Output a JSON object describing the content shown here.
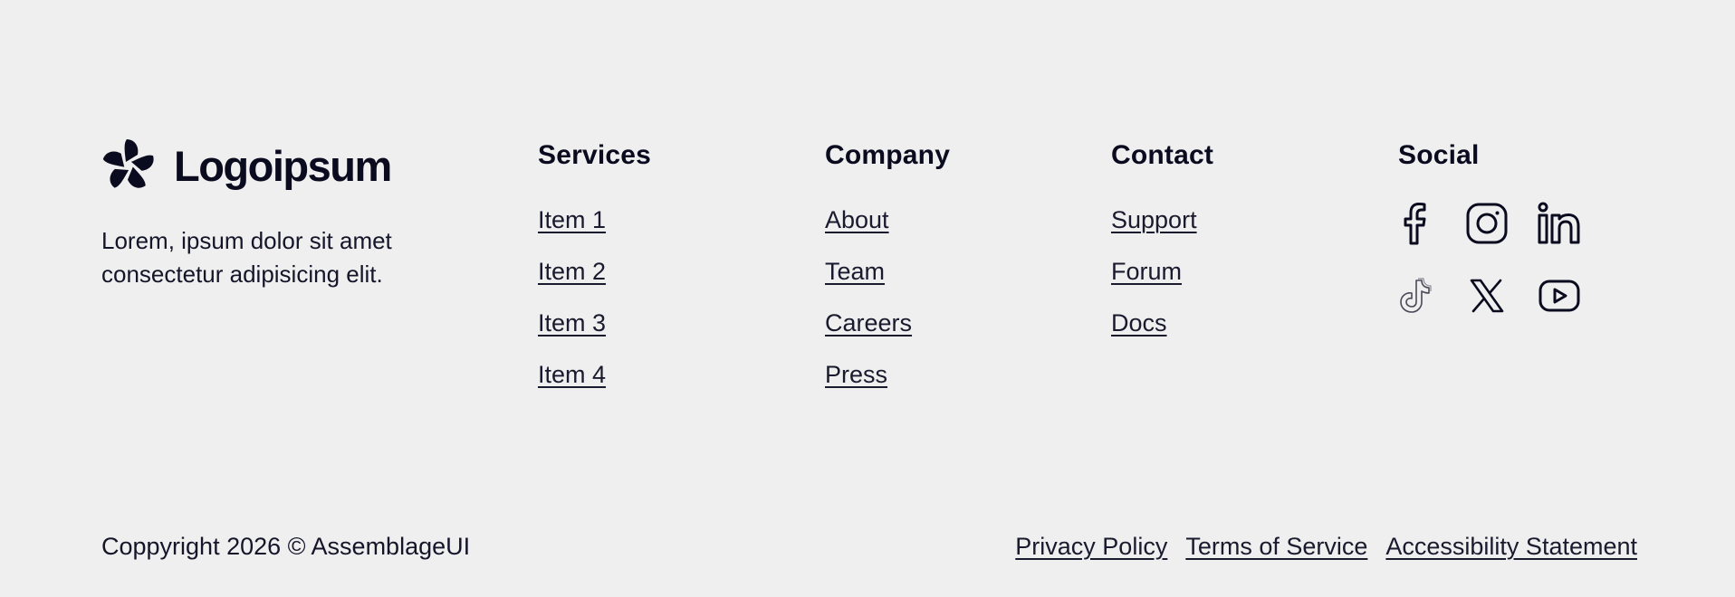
{
  "brand": {
    "name": "Logoipsum",
    "tagline": "Lorem, ipsum dolor sit amet consectetur adipisicing elit."
  },
  "columns": [
    {
      "heading": "Services",
      "links": [
        "Item 1",
        "Item 2",
        "Item 3",
        "Item 4"
      ]
    },
    {
      "heading": "Company",
      "links": [
        "About",
        "Team",
        "Careers",
        "Press"
      ]
    },
    {
      "heading": "Contact",
      "links": [
        "Support",
        "Forum",
        "Docs"
      ]
    }
  ],
  "social": {
    "heading": "Social",
    "icons": [
      "facebook-icon",
      "instagram-icon",
      "linkedin-icon",
      "tiktok-icon",
      "x-icon",
      "youtube-icon"
    ]
  },
  "bottom": {
    "copyright": "Coppyright 2026 © AssemblageUI",
    "legal_links": [
      "Privacy Policy",
      "Terms of Service",
      "Accessibility Statement"
    ]
  },
  "colors": {
    "background": "#efefef",
    "text": "#0b0b1f"
  }
}
